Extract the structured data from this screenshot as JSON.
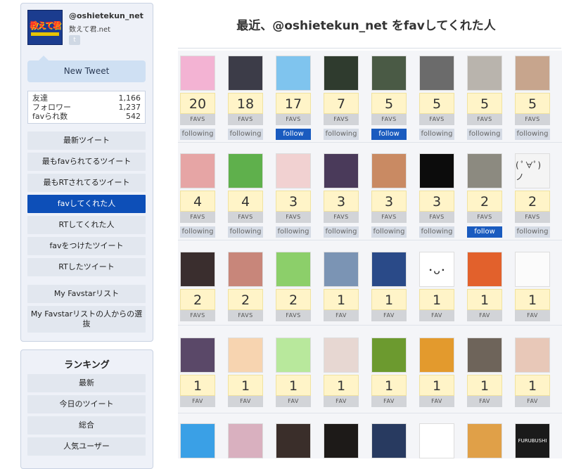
{
  "profile": {
    "handle": "@oshietekun_net",
    "name": "数えて君.net",
    "logo_text": "教えて君"
  },
  "sidebar": {
    "new_tweet": "New Tweet",
    "stats": [
      {
        "label": "友達",
        "value": "1,166"
      },
      {
        "label": "フォロワー",
        "value": "1,237"
      },
      {
        "label": "favられ数",
        "value": "542"
      }
    ],
    "menu": [
      "最新ツイート",
      "最もfavられてるツイート",
      "最もRTされてるツイート",
      "favしてくれた人",
      "RTしてくれた人",
      "favをつけたツイート",
      "RTしたツイート"
    ],
    "menu2": [
      "My Favstarリスト",
      "My Favstarリストの人からの選抜"
    ],
    "active_index": 3
  },
  "ranking": {
    "title": "ランキング",
    "items": [
      "最新",
      "今日のツイート",
      "総合",
      "人気ユーザー"
    ]
  },
  "main": {
    "title": "最近、@oshietekun_net をfavしてくれた人",
    "rows": [
      [
        {
          "count": "20",
          "label": "FAVS",
          "follow": "following",
          "color": "#f3b3d3"
        },
        {
          "count": "18",
          "label": "FAVS",
          "follow": "following",
          "color": "#3c3c48"
        },
        {
          "count": "17",
          "label": "FAVS",
          "follow": "follow",
          "color": "#7fc4ee"
        },
        {
          "count": "7",
          "label": "FAVS",
          "follow": "following",
          "color": "#2f3b2e"
        },
        {
          "count": "5",
          "label": "FAVS",
          "follow": "follow",
          "color": "#4a5a45"
        },
        {
          "count": "5",
          "label": "FAVS",
          "follow": "following",
          "color": "#6b6b6b"
        },
        {
          "count": "5",
          "label": "FAVS",
          "follow": "following",
          "color": "#b9b4ad"
        },
        {
          "count": "5",
          "label": "FAVS",
          "follow": "following",
          "color": "#c7a58d"
        }
      ],
      [
        {
          "count": "4",
          "label": "FAVS",
          "follow": "following",
          "color": "#e6a5a5"
        },
        {
          "count": "4",
          "label": "FAVS",
          "follow": "following",
          "color": "#5fb04c"
        },
        {
          "count": "3",
          "label": "FAVS",
          "follow": "following",
          "color": "#f1d1d1"
        },
        {
          "count": "3",
          "label": "FAVS",
          "follow": "following",
          "color": "#4a3a5a"
        },
        {
          "count": "3",
          "label": "FAVS",
          "follow": "following",
          "color": "#c98a63"
        },
        {
          "count": "3",
          "label": "FAVS",
          "follow": "following",
          "color": "#0c0c0c"
        },
        {
          "count": "2",
          "label": "FAVS",
          "follow": "follow",
          "color": "#8c8a80"
        },
        {
          "count": "2",
          "label": "FAVS",
          "follow": "following",
          "color": "#f4f4f4",
          "text": "( ﾟ∀ﾟ)ノ"
        }
      ],
      [
        {
          "count": "2",
          "label": "FAVS",
          "color": "#3a2e2e"
        },
        {
          "count": "2",
          "label": "FAVS",
          "color": "#c8867a"
        },
        {
          "count": "2",
          "label": "FAVS",
          "color": "#8ccf6a"
        },
        {
          "count": "1",
          "label": "FAV",
          "color": "#7b94b4"
        },
        {
          "count": "1",
          "label": "FAV",
          "color": "#2a4a88"
        },
        {
          "count": "1",
          "label": "FAV",
          "color": "#ffffff",
          "text": "･ᴗ･"
        },
        {
          "count": "1",
          "label": "FAV",
          "color": "#e2612c"
        },
        {
          "count": "1",
          "label": "FAV",
          "color": "#fbfbfb"
        }
      ],
      [
        {
          "count": "1",
          "label": "FAV",
          "color": "#5a4868"
        },
        {
          "count": "1",
          "label": "FAV",
          "color": "#f7d4b0"
        },
        {
          "count": "1",
          "label": "FAV",
          "color": "#b8e89c"
        },
        {
          "count": "1",
          "label": "FAV",
          "color": "#e7d7d2"
        },
        {
          "count": "1",
          "label": "FAV",
          "color": "#6c9a2f"
        },
        {
          "count": "1",
          "label": "FAV",
          "color": "#e39a2d"
        },
        {
          "count": "1",
          "label": "FAV",
          "color": "#6e645a"
        },
        {
          "count": "1",
          "label": "FAV",
          "color": "#e8c8b8"
        }
      ],
      [
        {
          "color": "#3aa0e6"
        },
        {
          "color": "#d9b0bf"
        },
        {
          "color": "#3a2e2a"
        },
        {
          "color": "#1d1a18"
        },
        {
          "color": "#283a60"
        },
        {
          "color": "#ffffff"
        },
        {
          "color": "#e0a048"
        },
        {
          "color": "#1a1a1a",
          "text": "FURUBUSHI"
        }
      ]
    ]
  }
}
